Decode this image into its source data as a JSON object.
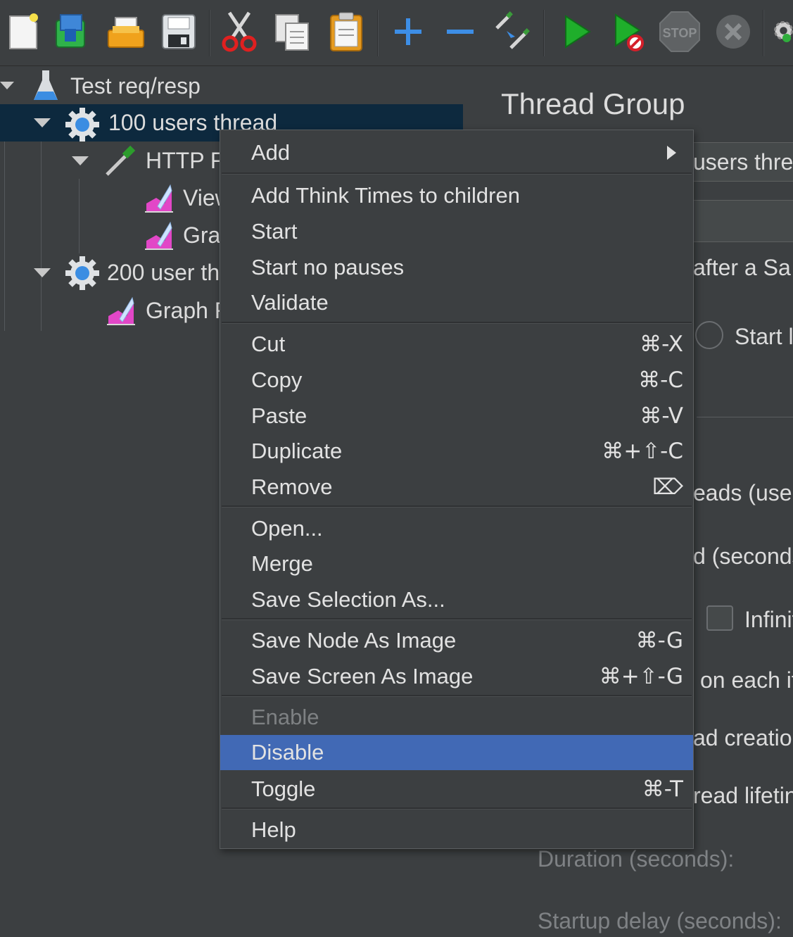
{
  "toolbar": {
    "buttons": [
      {
        "name": "new-icon"
      },
      {
        "name": "templates-icon"
      },
      {
        "name": "open-icon"
      },
      {
        "name": "save-icon"
      },
      {
        "name": "cut-icon"
      },
      {
        "name": "copy-icon"
      },
      {
        "name": "paste-icon"
      },
      {
        "name": "expand-all-icon"
      },
      {
        "name": "collapse-all-icon"
      },
      {
        "name": "toggle-icon"
      },
      {
        "name": "start-icon"
      },
      {
        "name": "start-no-pauses-icon"
      },
      {
        "name": "stop-icon",
        "label": "STOP"
      },
      {
        "name": "shutdown-icon"
      },
      {
        "name": "clear-icon"
      }
    ]
  },
  "tree": {
    "root": {
      "label": "Test req/resp"
    },
    "items": [
      {
        "label": "100 users thread",
        "selected": true
      },
      {
        "label": "HTTP F"
      },
      {
        "label": "View"
      },
      {
        "label": "Gra"
      },
      {
        "label": "200 user th"
      },
      {
        "label": "Graph R"
      }
    ]
  },
  "panel": {
    "title": "Thread Group",
    "name_value": "users threa",
    "action_label": "after a Sa",
    "start_label": "Start l",
    "threads_label": "eads (users",
    "rampup_label": "d (seconds",
    "infinite_label": "Infinit",
    "same_user_label": "on each it",
    "delay_label": "ad creation",
    "lifetime_label": "read lifetin",
    "duration_label": "Duration (seconds):",
    "startup_label": "Startup delay (seconds):"
  },
  "context_menu": {
    "items": [
      {
        "label": "Add",
        "submenu": true
      },
      {
        "label": "Add Think Times to children"
      },
      {
        "label": "Start"
      },
      {
        "label": "Start no pauses"
      },
      {
        "label": "Validate"
      },
      {
        "label": "Cut",
        "shortcut": "⌘-X"
      },
      {
        "label": "Copy",
        "shortcut": "⌘-C"
      },
      {
        "label": "Paste",
        "shortcut": "⌘-V"
      },
      {
        "label": "Duplicate",
        "shortcut": "⌘+⇧-C"
      },
      {
        "label": "Remove",
        "shortcut": "⌦"
      },
      {
        "label": "Open..."
      },
      {
        "label": "Merge"
      },
      {
        "label": "Save Selection As..."
      },
      {
        "label": "Save Node As Image",
        "shortcut": "⌘-G"
      },
      {
        "label": "Save Screen As Image",
        "shortcut": "⌘+⇧-G"
      },
      {
        "label": "Enable",
        "disabled": true
      },
      {
        "label": "Disable",
        "highlighted": true
      },
      {
        "label": "Toggle",
        "shortcut": "⌘-T"
      },
      {
        "label": "Help"
      }
    ]
  },
  "colors": {
    "background": "#3c3f41",
    "selection": "#0d293e",
    "menu_highlight": "#4169b5",
    "disabled_text": "#7e8183"
  }
}
